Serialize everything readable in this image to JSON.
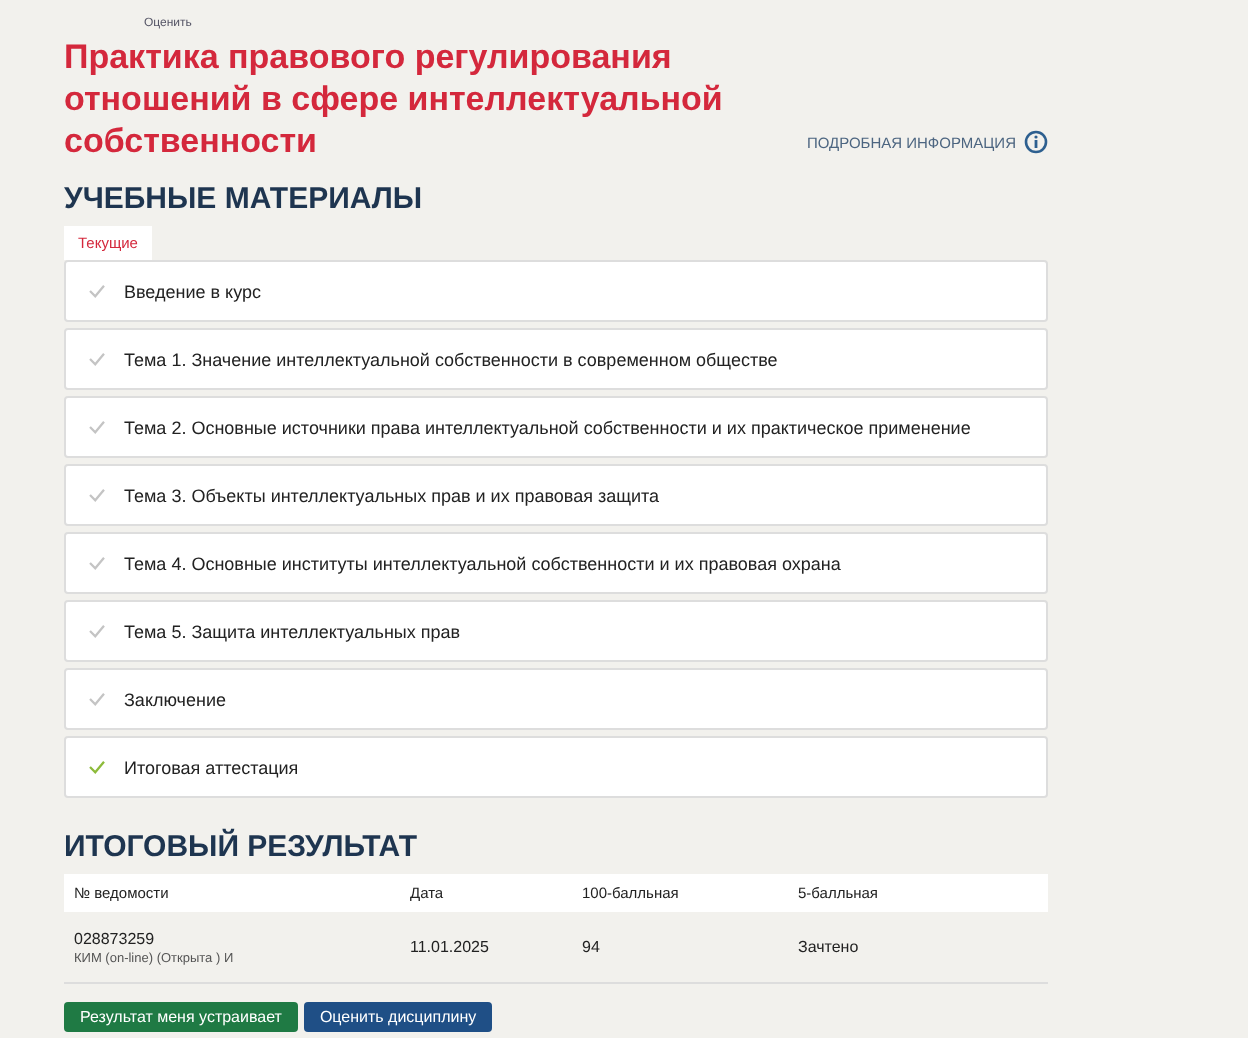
{
  "top_link": "Оценить",
  "title": "Практика правового регулирования отношений в сфере интеллектуальной собственности",
  "info_link": "ПОДРОБНАЯ ИНФОРМАЦИЯ",
  "materials": {
    "heading": "УЧЕБНЫЕ МАТЕРИАЛЫ",
    "tabs": [
      {
        "label": "Текущие",
        "selected": true
      }
    ],
    "items": [
      {
        "title": "Введение в курс",
        "passed": false
      },
      {
        "title": "Тема 1. Значение интеллектуальной собственности в современном обществе",
        "passed": false
      },
      {
        "title": "Тема 2. Основные источники права интеллектуальной собственности и их практическое применение",
        "passed": false
      },
      {
        "title": "Тема 3. Объекты интеллектуальных прав и их правовая защита",
        "passed": false
      },
      {
        "title": "Тема 4. Основные институты интеллектуальной собственности и их правовая охрана",
        "passed": false
      },
      {
        "title": "Тема 5. Защита интеллектуальных прав",
        "passed": false
      },
      {
        "title": "Заключение",
        "passed": false
      },
      {
        "title": "Итоговая аттестация",
        "passed": true
      }
    ]
  },
  "result": {
    "heading": "ИТОГОВЫЙ РЕЗУЛЬТАТ",
    "columns": [
      "№ ведомости",
      "Дата",
      "100-балльная",
      "5-балльная"
    ],
    "rows": [
      {
        "number": "028873259",
        "note": "КИМ (on-line) (Открыта ) И",
        "date": "11.01.2025",
        "score100": "94",
        "score5": "Зачтено"
      }
    ]
  },
  "buttons": [
    {
      "label": "Результат меня устраивает",
      "kind": "accept"
    },
    {
      "label": "Оценить дисциплину",
      "kind": "rate"
    }
  ]
}
